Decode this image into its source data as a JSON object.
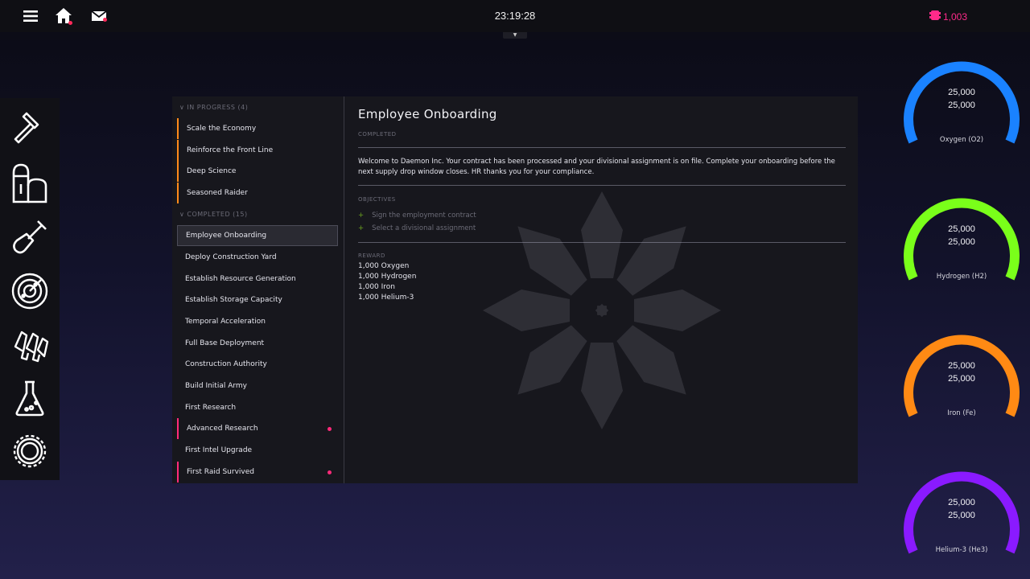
{
  "topbar": {
    "clock": "23:19:28",
    "currency_value": "1,003",
    "currency_color": "#ff2a8a",
    "icons": [
      "menu-icon",
      "home-icon",
      "mail-icon",
      "credits-icon"
    ]
  },
  "leftbar": {
    "tools": [
      "hammer-icon",
      "silo-icon",
      "shovel-icon",
      "radar-icon",
      "ammo-icon",
      "flask-icon",
      "gear-icon"
    ]
  },
  "questlist": {
    "in_progress_header": "∨ IN PROGRESS (4)",
    "completed_header": "∨ COMPLETED (15)",
    "in_progress": [
      {
        "label": "Scale the Economy"
      },
      {
        "label": "Reinforce the Front Line"
      },
      {
        "label": "Deep Science"
      },
      {
        "label": "Seasoned Raider"
      }
    ],
    "completed": [
      {
        "label": "Employee Onboarding",
        "selected": true
      },
      {
        "label": "Deploy Construction Yard"
      },
      {
        "label": "Establish Resource Generation"
      },
      {
        "label": "Establish Storage Capacity"
      },
      {
        "label": "Temporal Acceleration"
      },
      {
        "label": "Full Base Deployment"
      },
      {
        "label": "Construction Authority"
      },
      {
        "label": "Build Initial Army"
      },
      {
        "label": "First Research"
      },
      {
        "label": "Advanced Research",
        "new": true
      },
      {
        "label": "First Intel Upgrade"
      },
      {
        "label": "First Raid Survived",
        "new": true
      }
    ]
  },
  "detail": {
    "title": "Employee Onboarding",
    "status": "COMPLETED",
    "description": "Welcome to Daemon Inc. Your contract has been processed and your divisional assignment is on file. Complete your onboarding before the next supply drop window closes. HR thanks you for your compliance.",
    "objectives_header": "OBJECTIVES",
    "objectives": [
      "Sign the employment contract",
      "Select a divisional assignment"
    ],
    "reward_header": "REWARD",
    "rewards": [
      "1,000 Oxygen",
      "1,000 Hydrogen",
      "1,000 Iron",
      "1,000 Helium-3"
    ]
  },
  "gauges": [
    {
      "label": "Oxygen (O2)",
      "current": "25,000",
      "capacity": "25,000",
      "fill": 1.0,
      "color": "#1a82ff"
    },
    {
      "label": "Hydrogen (H2)",
      "current": "25,000",
      "capacity": "25,000",
      "fill": 1.0,
      "color": "#7aff1a"
    },
    {
      "label": "Iron (Fe)",
      "current": "25,000",
      "capacity": "25,000",
      "fill": 1.0,
      "color": "#ff8a14"
    },
    {
      "label": "Helium-3 (He3)",
      "current": "25,000",
      "capacity": "25,000",
      "fill": 1.0,
      "color": "#8a1aff"
    }
  ]
}
